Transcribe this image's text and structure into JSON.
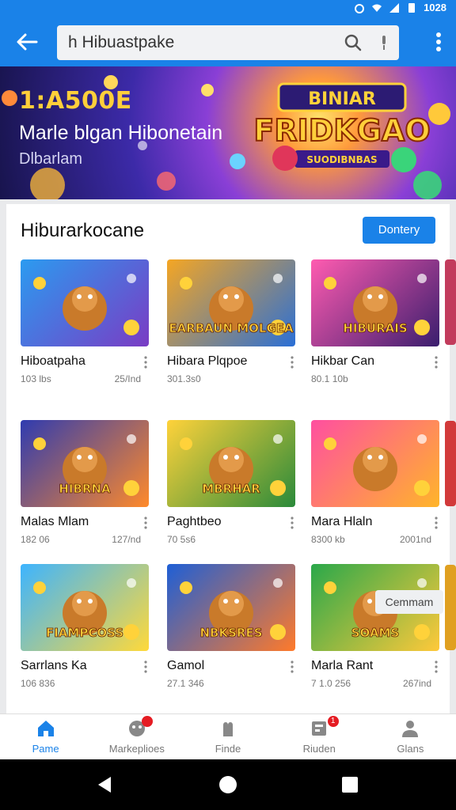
{
  "status_bar": {
    "time": "1028"
  },
  "search": {
    "query": "h Hibuastpake"
  },
  "banner": {
    "line1": "1:A500E",
    "headline": "Marle blgan Hibonetain",
    "subline": "Dlbarlam",
    "logo_lines": [
      "BINIAR",
      "FRIDKGAO",
      "SUODIBNBAS"
    ]
  },
  "section": {
    "title": "Hiburarkocane",
    "more_label": "Dontery",
    "confirm_label": "Cemmam"
  },
  "tiles": [
    {
      "name": "Hiboatpaha",
      "meta_left": "103 lbs",
      "meta_right": "25/Ind",
      "art_text": "",
      "bg1": "#2b9bf0",
      "bg2": "#7a3cc4"
    },
    {
      "name": "Hibara Plqpoe",
      "meta_left": "301.3s0",
      "meta_right": "",
      "art_text": "EARBAUN MOLGEA",
      "bg1": "#f5a623",
      "bg2": "#2a6fd6"
    },
    {
      "name": "Hikbar Can",
      "meta_left": "80.1 10b",
      "meta_right": "",
      "art_text": "HIBURAIS",
      "bg1": "#ff5bb0",
      "bg2": "#3a1e6e"
    },
    {
      "name": "Malas Mlam",
      "meta_left": "182 06",
      "meta_right": "127/nd",
      "art_text": "HIBRNA",
      "bg1": "#2f3bb0",
      "bg2": "#ff8a2a"
    },
    {
      "name": "Paghtbeo",
      "meta_left": "70 5s6",
      "meta_right": "",
      "art_text": "MBRHAR",
      "bg1": "#ffd23a",
      "bg2": "#2a8a3a"
    },
    {
      "name": "Mara Hlaln",
      "meta_left": "8300 kb",
      "meta_right": "2001nd",
      "art_text": "",
      "bg1": "#ff4fa0",
      "bg2": "#ffb52a"
    },
    {
      "name": "Sarrlans Ka",
      "meta_left": "106 836",
      "meta_right": "",
      "art_text": "FIAMPCOSS",
      "bg1": "#3db4ff",
      "bg2": "#ffd93a"
    },
    {
      "name": "Gamol",
      "meta_left": "27.1 346",
      "meta_right": "",
      "art_text": "NBKSRES",
      "bg1": "#1e5fd6",
      "bg2": "#ff7a2a"
    },
    {
      "name": "Marla Rant",
      "meta_left": "7 1.0 256",
      "meta_right": "267ind",
      "art_text": "SOAMS",
      "bg1": "#2aa84a",
      "bg2": "#ffc93a"
    }
  ],
  "bottom_nav": [
    {
      "label": "Pame",
      "icon": "home-icon",
      "active": true
    },
    {
      "label": "Markeplioes",
      "icon": "market-icon",
      "badge": ""
    },
    {
      "label": "Finde",
      "icon": "hands-icon"
    },
    {
      "label": "Riuden",
      "icon": "inbox-icon",
      "badge": "1"
    },
    {
      "label": "Glans",
      "icon": "profile-icon"
    }
  ],
  "colors": {
    "primary": "#1a82e8",
    "badge": "#e51c23"
  }
}
